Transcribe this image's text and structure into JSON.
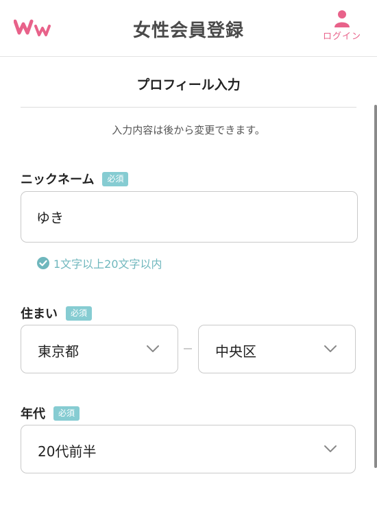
{
  "header": {
    "title": "女性会員登録",
    "logo_icon": "ww-logo",
    "login_label": "ログイン",
    "login_icon": "user-icon",
    "accent_color": "#e8628a"
  },
  "section": {
    "title": "プロフィール入力",
    "note": "入力内容は後から変更できます。"
  },
  "form": {
    "required_badge": "必須",
    "badge_color": "#86ccd2",
    "nickname": {
      "label": "ニックネーム",
      "value": "ゆき",
      "validation": "1文字以上20文字以内",
      "validation_color": "#6fb7bd"
    },
    "residence": {
      "label": "住まい",
      "prefecture": "東京都",
      "city": "中央区"
    },
    "age": {
      "label": "年代",
      "value": "20代前半"
    }
  }
}
